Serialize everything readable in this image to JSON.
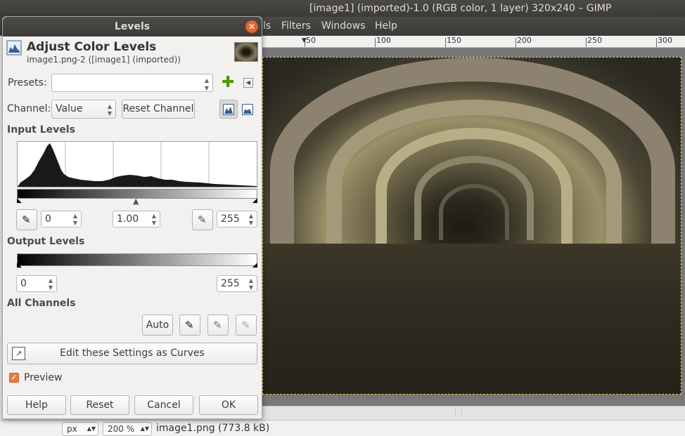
{
  "window": {
    "title": "[image1] (imported)-1.0 (RGB color, 1 layer) 320x240 – GIMP"
  },
  "menubar": {
    "items": [
      "ls",
      "Filters",
      "Windows",
      "Help"
    ]
  },
  "ruler": {
    "labels": [
      "50",
      "100",
      "150",
      "200",
      "250",
      "300"
    ]
  },
  "statusbar": {
    "unit": "px",
    "zoom": "200 %",
    "file": "image1.png (773.8 kB)"
  },
  "dialog": {
    "title": "Levels",
    "header": "Adjust Color Levels",
    "subheader": "image1.png-2 ([image1] (imported))",
    "presets_label": "Presets:",
    "presets_value": "",
    "channel_label": "Channel:",
    "channel_value": "Value",
    "reset_channel": "Reset Channel",
    "input_levels": "Input Levels",
    "input_low": "0",
    "input_gamma": "1.00",
    "input_high": "255",
    "output_levels": "Output Levels",
    "output_low": "0",
    "output_high": "255",
    "all_channels": "All Channels",
    "auto": "Auto",
    "edit_curves": "Edit these Settings as Curves",
    "preview_label": "Preview",
    "preview_checked": true,
    "buttons": {
      "help": "Help",
      "reset": "Reset",
      "cancel": "Cancel",
      "ok": "OK"
    }
  },
  "colors": {
    "accent": "#ee7a3a",
    "close": "#e05a2a",
    "titlebar": "#3c3b37"
  }
}
